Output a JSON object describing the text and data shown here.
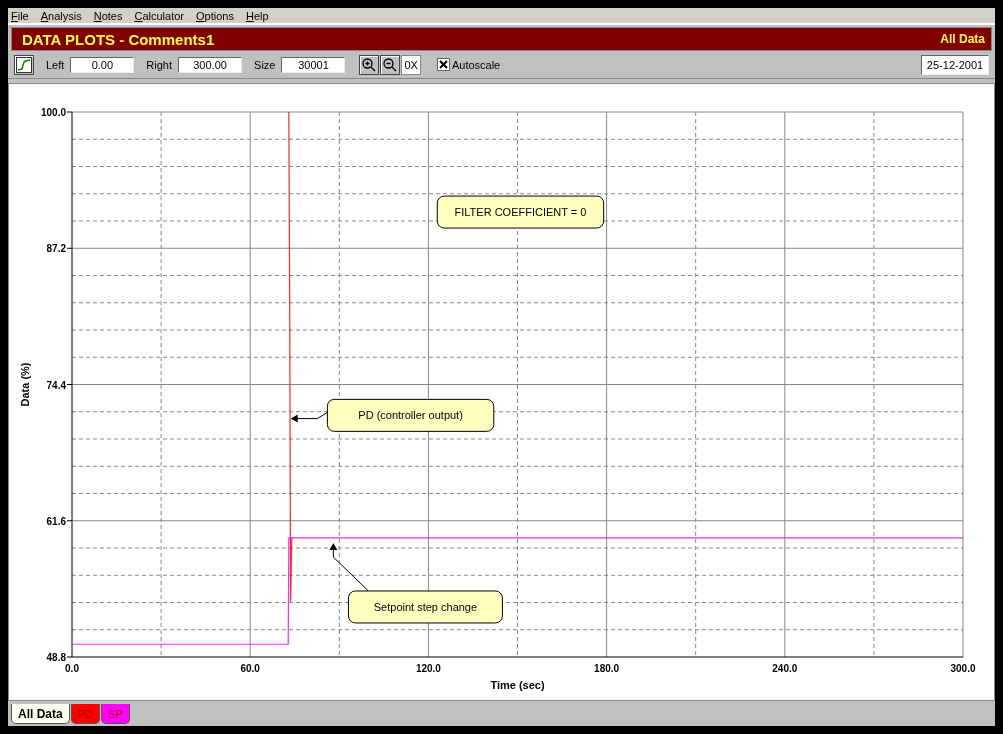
{
  "menu": [
    "File",
    "Analysis",
    "Notes",
    "Calculator",
    "Options",
    "Help"
  ],
  "title_bar": {
    "title": "DATA PLOTS - Comments1",
    "view": "All Data"
  },
  "toolbar": {
    "left_label": "Left",
    "left_value": "0.00",
    "right_label": "Right",
    "right_value": "300.00",
    "size_label": "Size",
    "size_value": "30001",
    "reset_label": "0X",
    "autoscale": {
      "label": "Autoscale",
      "checked": true
    },
    "date": "25-12-2001"
  },
  "plot": {
    "chart_data": {
      "type": "line",
      "grid": true,
      "xlabel": "Time (sec)",
      "ylabel": "Data (%)",
      "xlim": [
        0,
        300
      ],
      "ylim": [
        48.8,
        100
      ],
      "xticks": [
        {
          "value": 0,
          "label": "0.0"
        },
        {
          "value": 60,
          "label": "60.0"
        },
        {
          "value": 120,
          "label": "120.0"
        },
        {
          "value": 180,
          "label": "180.0"
        },
        {
          "value": 240,
          "label": "240.0"
        },
        {
          "value": 300,
          "label": "300.0"
        }
      ],
      "yticks": [
        {
          "value": 48.8,
          "label": "48.8"
        },
        {
          "value": 61.6,
          "label": "61.6"
        },
        {
          "value": 74.4,
          "label": "74.4"
        },
        {
          "value": 87.2,
          "label": "87.2"
        },
        {
          "value": 100,
          "label": "100.0"
        }
      ],
      "x": [
        0,
        72.8,
        73,
        73.3,
        73.6,
        74,
        300
      ],
      "series": [
        {
          "name": "PD",
          "color": "#ff0000",
          "values": [
            null,
            null,
            100,
            82,
            54,
            60,
            null
          ]
        },
        {
          "name": "SP",
          "color": "#ff00ff",
          "values": [
            50,
            50,
            60,
            60,
            60,
            60,
            60
          ]
        }
      ],
      "annotations": [
        "FILTER COEFFICIENT = 0",
        "PD (controller output)",
        "Setpoint step change"
      ]
    }
  },
  "tabs": [
    {
      "label": "All Data",
      "selected": true,
      "color": "#fffff0"
    },
    {
      "selected": false
    },
    {
      "selected": false
    }
  ]
}
